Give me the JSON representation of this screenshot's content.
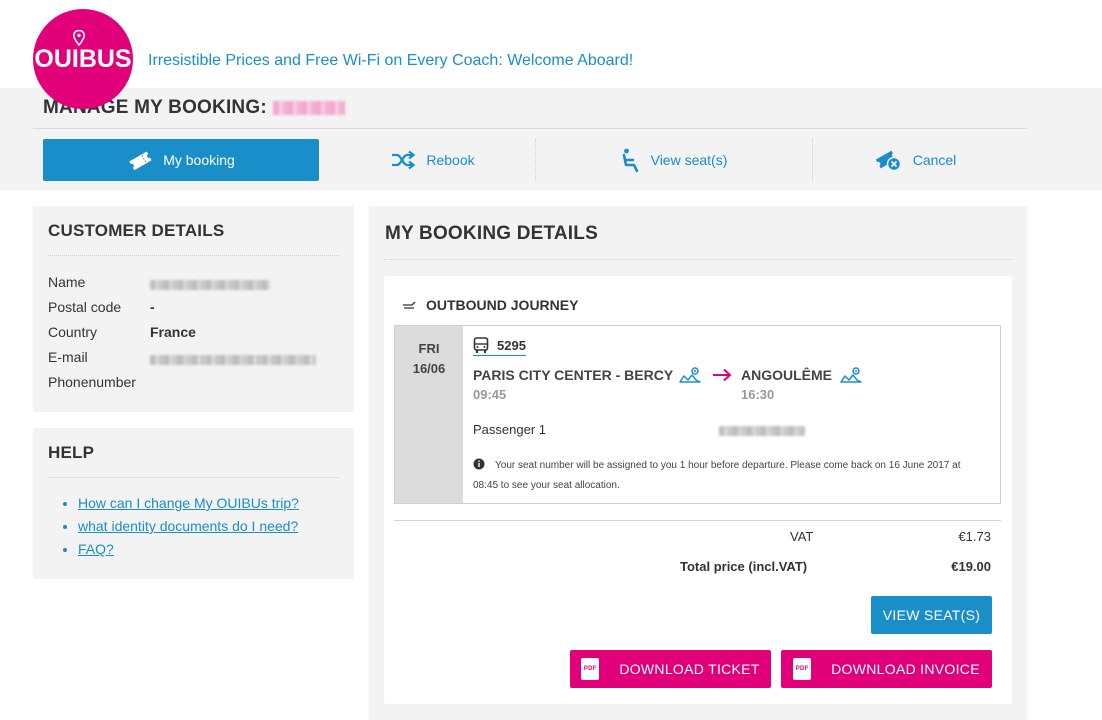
{
  "brand": {
    "logo_text": "OUIBUS",
    "tagline": "Irresistible Prices and Free Wi-Fi on Every Coach: Welcome Aboard!"
  },
  "manage": {
    "title": "MANAGE MY BOOKING:"
  },
  "tabs": [
    {
      "label": "My booking",
      "icon": "ticket-icon",
      "active": true
    },
    {
      "label": "Rebook",
      "icon": "shuffle-icon",
      "active": false
    },
    {
      "label": "View seat(s)",
      "icon": "seat-icon",
      "active": false
    },
    {
      "label": "Cancel",
      "icon": "cancel-ticket-icon",
      "active": false
    }
  ],
  "customer": {
    "heading": "CUSTOMER DETAILS",
    "fields": [
      {
        "label": "Name",
        "value": ""
      },
      {
        "label": "Postal code",
        "value": "-"
      },
      {
        "label": "Country",
        "value": "France"
      },
      {
        "label": "E-mail",
        "value": ""
      },
      {
        "label": "Phonenumber",
        "value": ""
      }
    ]
  },
  "help": {
    "heading": "HELP",
    "links": [
      "How can I change My OUIBUs trip?",
      "what identity documents do I need?",
      "FAQ?"
    ]
  },
  "booking": {
    "heading": "MY BOOKING DETAILS",
    "outbound_label": "OUTBOUND JOURNEY",
    "day": "FRI",
    "date": "16/06",
    "bus_number": "5295",
    "from_station": "PARIS CITY CENTER - BERCY",
    "from_time": "09:45",
    "to_station": "ANGOULÊME",
    "to_time": "16:30",
    "passenger_label": "Passenger 1",
    "seat_notice": "Your seat number will be assigned to you 1 hour before departure. Please come back on 16 June 2017 at 08:45 to see your seat allocation.",
    "vat_label": "VAT",
    "vat_value": "€1.73",
    "total_label": "Total price (incl.VAT)",
    "total_value": "€19.00",
    "view_seats_label": "VIEW SEAT(S)",
    "download_ticket_label": "DOWNLOAD TICKET",
    "download_invoice_label": "DOWNLOAD INVOICE",
    "pdf_icon_text": "PDF"
  },
  "colors": {
    "brand_pink": "#e2007a",
    "accent_blue": "#1a8ec8",
    "panel_gray": "#f3f3f3"
  }
}
